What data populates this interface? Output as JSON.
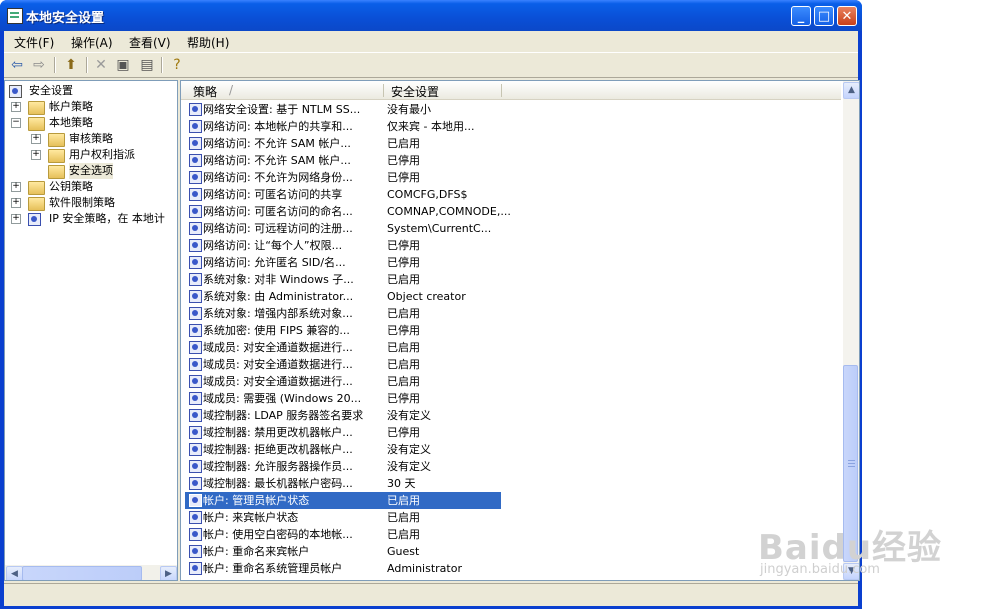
{
  "window": {
    "title": "本地安全设置"
  },
  "menu": [
    "文件(F)",
    "操作(A)",
    "查看(V)",
    "帮助(H)"
  ],
  "tree": [
    {
      "label": "安全设置",
      "expander": ""
    },
    {
      "label": "帐户策略",
      "expander": "+"
    },
    {
      "label": "本地策略",
      "expander": "−"
    },
    {
      "label": "审核策略",
      "expander": "+"
    },
    {
      "label": "用户权利指派",
      "expander": "+"
    },
    {
      "label": "安全选项",
      "expander": ""
    },
    {
      "label": "公钥策略",
      "expander": "+"
    },
    {
      "label": "软件限制策略",
      "expander": "+"
    },
    {
      "label": "IP 安全策略，在 本地计",
      "expander": "+"
    }
  ],
  "list": {
    "columns": [
      "策略",
      "安全设置"
    ],
    "sort_indicator": "/",
    "rows": [
      {
        "policy": "网络安全设置: 基于 NTLM SS...",
        "setting": "没有最小"
      },
      {
        "policy": "网络访问: 本地帐户的共享和...",
        "setting": "仅来宾 - 本地用..."
      },
      {
        "policy": "网络访问: 不允许 SAM 帐户...",
        "setting": "已启用"
      },
      {
        "policy": "网络访问: 不允许 SAM 帐户...",
        "setting": "已停用"
      },
      {
        "policy": "网络访问: 不允许为网络身份...",
        "setting": "已停用"
      },
      {
        "policy": "网络访问: 可匿名访问的共享",
        "setting": "COMCFG,DFS$"
      },
      {
        "policy": "网络访问: 可匿名访问的命名...",
        "setting": "COMNAP,COMNODE,..."
      },
      {
        "policy": "网络访问: 可远程访问的注册...",
        "setting": "System\\CurrentC..."
      },
      {
        "policy": "网络访问: 让“每个人”权限...",
        "setting": "已停用"
      },
      {
        "policy": "网络访问: 允许匿名 SID/名...",
        "setting": "已停用"
      },
      {
        "policy": "系统对象: 对非 Windows 子...",
        "setting": "已启用"
      },
      {
        "policy": "系统对象: 由 Administrator...",
        "setting": "Object creator"
      },
      {
        "policy": "系统对象: 增强内部系统对象...",
        "setting": "已启用"
      },
      {
        "policy": "系统加密: 使用 FIPS 兼容的...",
        "setting": "已停用"
      },
      {
        "policy": "域成员: 对安全通道数据进行...",
        "setting": "已启用"
      },
      {
        "policy": "域成员: 对安全通道数据进行...",
        "setting": "已启用"
      },
      {
        "policy": "域成员: 对安全通道数据进行...",
        "setting": "已启用"
      },
      {
        "policy": "域成员: 需要强 (Windows 20...",
        "setting": "已停用"
      },
      {
        "policy": "域控制器: LDAP 服务器签名要求",
        "setting": "没有定义"
      },
      {
        "policy": "域控制器: 禁用更改机器帐户...",
        "setting": "已停用"
      },
      {
        "policy": "域控制器: 拒绝更改机器帐户...",
        "setting": "没有定义"
      },
      {
        "policy": "域控制器: 允许服务器操作员...",
        "setting": "没有定义"
      },
      {
        "policy": "域控制器: 最长机器帐户密码...",
        "setting": "30 天"
      },
      {
        "policy": "帐户: 管理员帐户状态",
        "setting": "已启用"
      },
      {
        "policy": "帐户: 来宾帐户状态",
        "setting": "已启用"
      },
      {
        "policy": "帐户: 使用空白密码的本地帐...",
        "setting": "已启用"
      },
      {
        "policy": "帐户: 重命名来宾帐户",
        "setting": "Guest"
      },
      {
        "policy": "帐户: 重命名系统管理员帐户",
        "setting": "Administrator"
      }
    ]
  },
  "watermark": {
    "logo": "Baidu经验",
    "url": "jingyan.baidu.com"
  },
  "icons": {
    "back": "back-arrow-icon",
    "forward": "forward-arrow-icon",
    "up": "up-folder-icon",
    "delete": "delete-icon",
    "properties": "properties-icon",
    "export": "export-list-icon",
    "help": "help-icon"
  }
}
